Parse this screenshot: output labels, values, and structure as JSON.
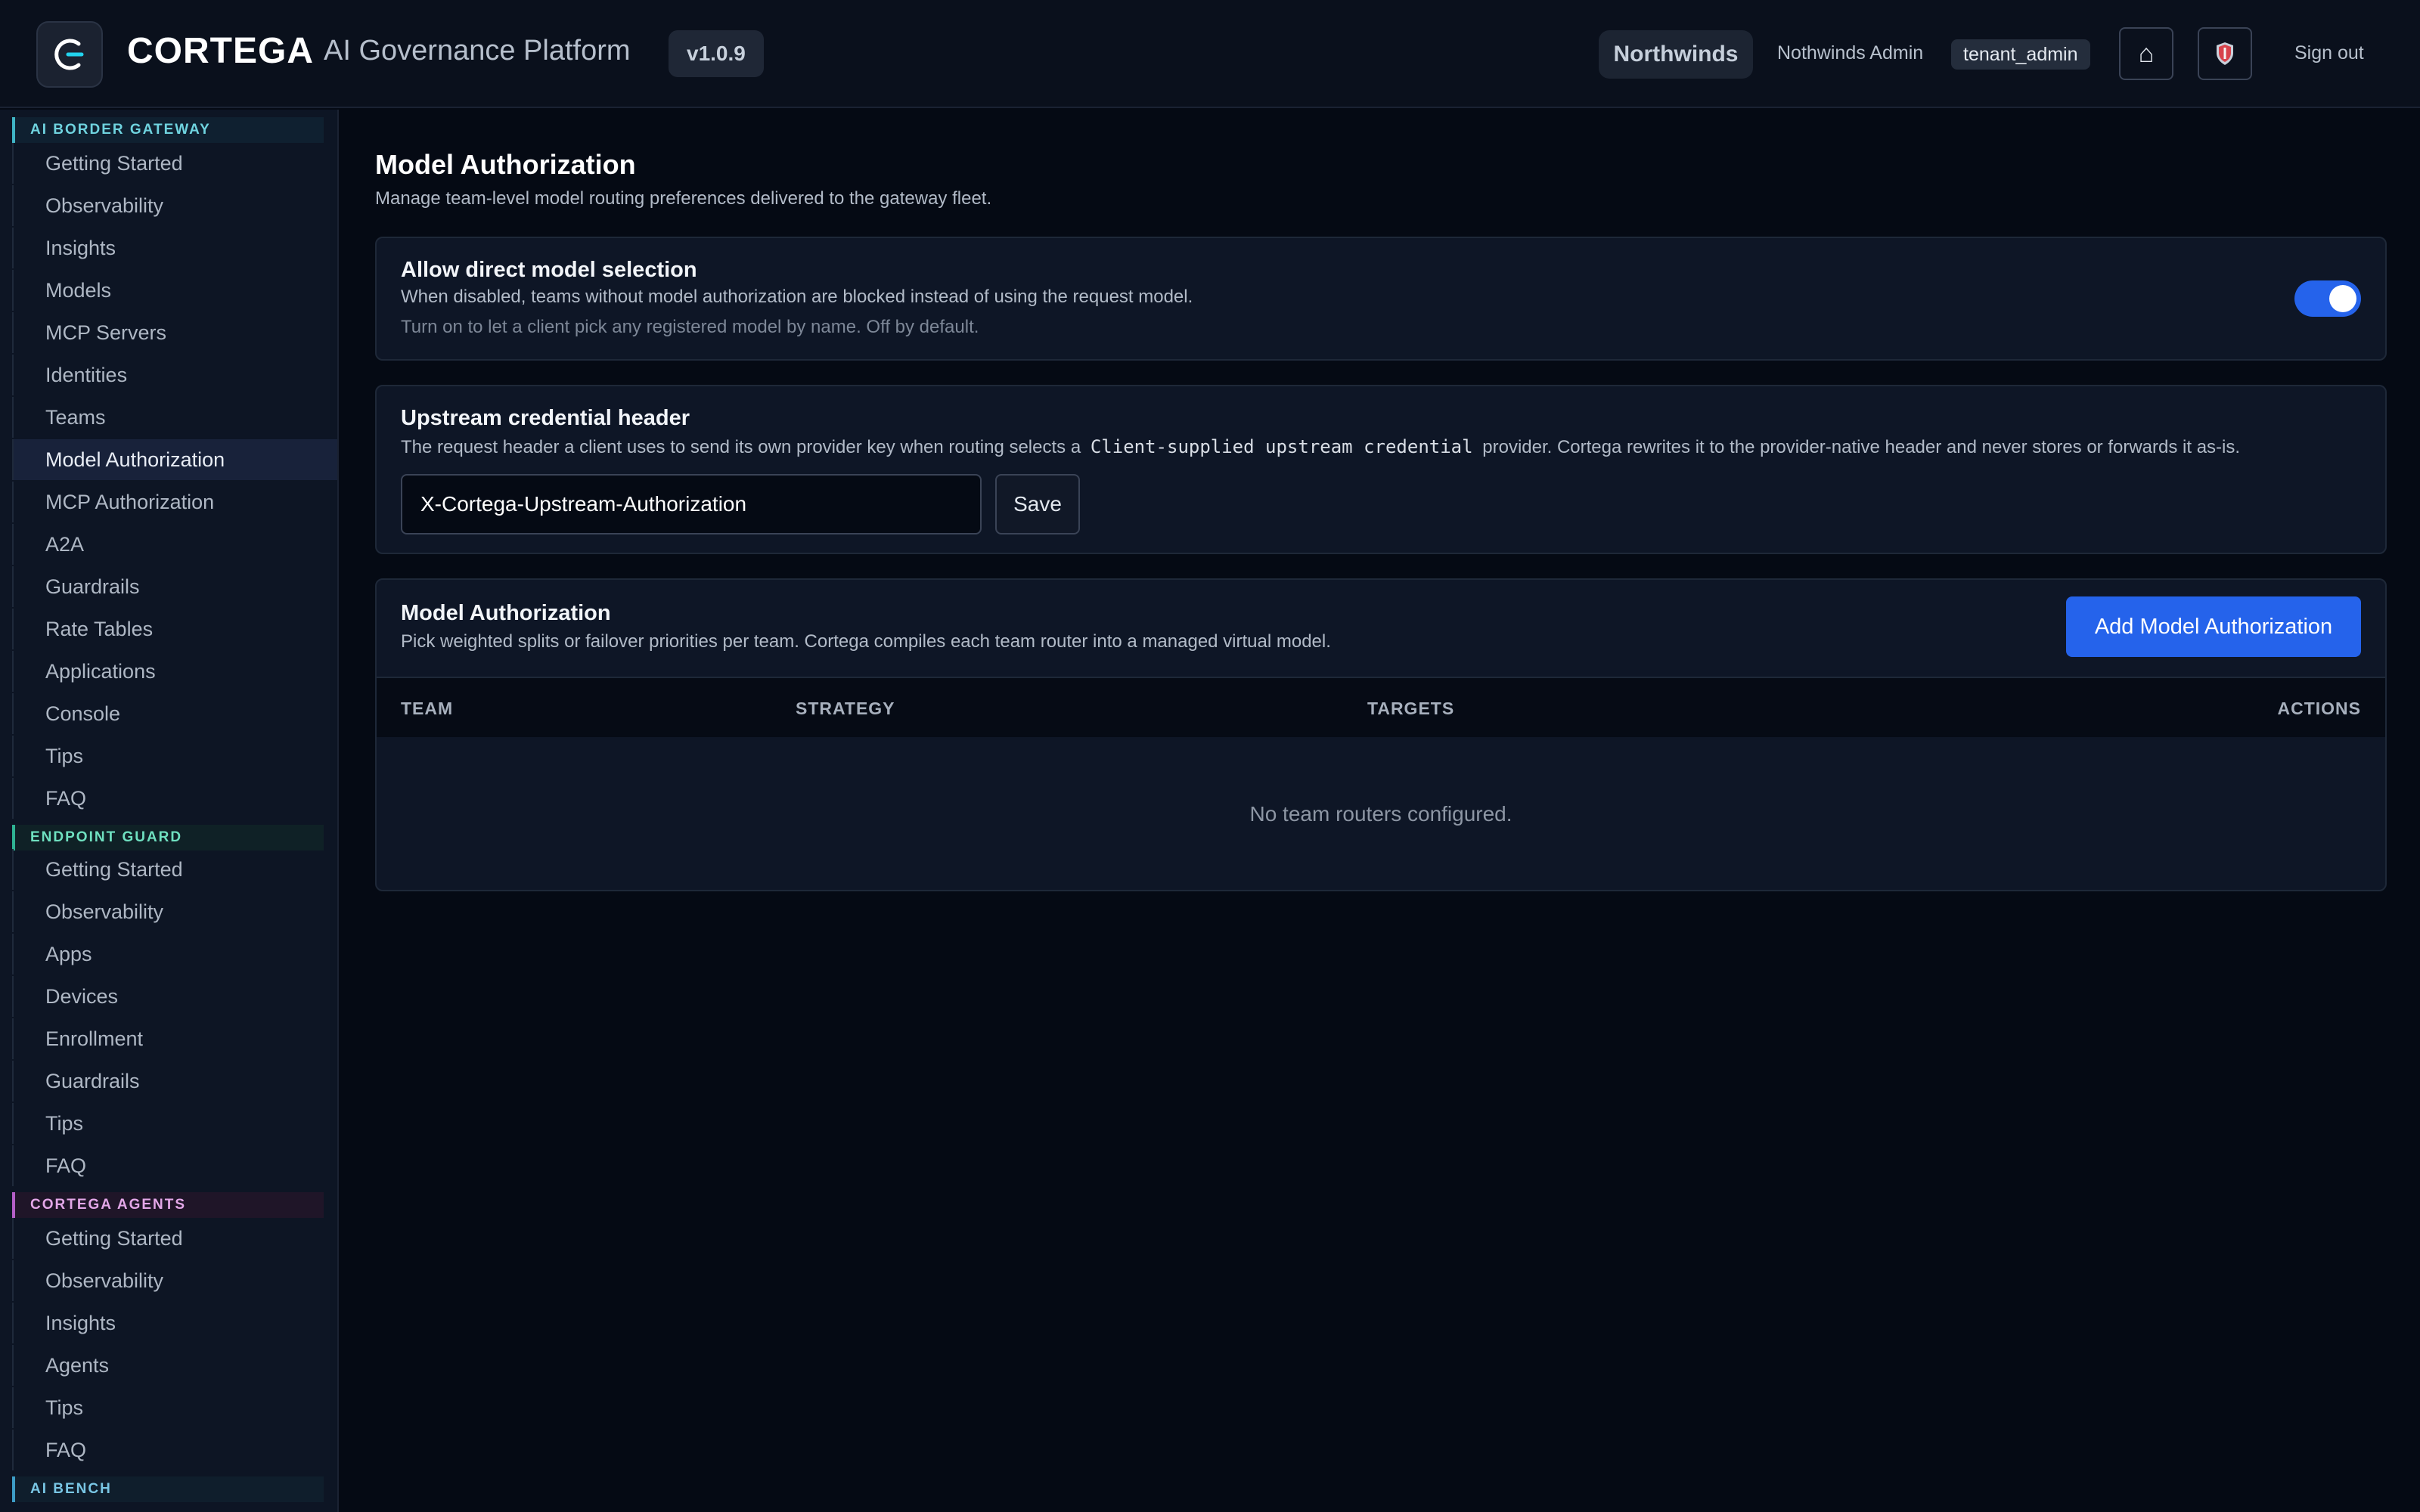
{
  "header": {
    "brand": "CORTEGA",
    "subtitle": "AI Governance Platform",
    "version": "v1.0.9",
    "tenant": "Northwinds",
    "user": "Nothwinds Admin",
    "role": "tenant_admin",
    "home_icon": "⌂",
    "signout": "Sign out"
  },
  "sidebar": {
    "gateway": {
      "label": "AI BORDER GATEWAY",
      "items": [
        "Getting Started",
        "Observability",
        "Insights",
        "Models",
        "MCP Servers",
        "Identities",
        "Teams",
        "Model Authorization",
        "MCP Authorization",
        "A2A",
        "Guardrails",
        "Rate Tables",
        "Applications",
        "Console",
        "Tips",
        "FAQ"
      ]
    },
    "endpoint": {
      "label": "ENDPOINT GUARD",
      "items": [
        "Getting Started",
        "Observability",
        "Apps",
        "Devices",
        "Enrollment",
        "Guardrails",
        "Tips",
        "FAQ"
      ]
    },
    "agents": {
      "label": "CORTEGA AGENTS",
      "items": [
        "Getting Started",
        "Observability",
        "Insights",
        "Agents",
        "Tips",
        "FAQ"
      ]
    },
    "bench": {
      "label": "AI BENCH"
    },
    "active_item": "Model Authorization"
  },
  "page": {
    "title": "Model Authorization",
    "description": "Manage team-level model routing preferences delivered to the gateway fleet."
  },
  "direct_selection": {
    "title": "Allow direct model selection",
    "description": "When disabled, teams without model authorization are blocked instead of using the request model.",
    "hint": "Turn on to let a client pick any registered model by name. Off by default.",
    "enabled": true
  },
  "credential_header": {
    "title": "Upstream credential header",
    "desc_before": "The request header a client uses to send its own provider key when routing selects a",
    "desc_code": "Client-supplied upstream credential",
    "desc_after": "provider. Cortega rewrites it to the provider-native header and never stores or forwards it as-is.",
    "value": "X-Cortega-Upstream-Authorization",
    "save_label": "Save"
  },
  "authorizations": {
    "title": "Model Authorization",
    "description": "Pick weighted splits or failover priorities per team. Cortega compiles each team router into a managed virtual model.",
    "add_label": "Add Model Authorization",
    "columns": [
      "TEAM",
      "STRATEGY",
      "TARGETS",
      "ACTIONS"
    ],
    "empty": "No team routers configured."
  },
  "colors": {
    "accent": "#2563eb",
    "background": "#050a14",
    "sidebar": "#0d1524"
  }
}
